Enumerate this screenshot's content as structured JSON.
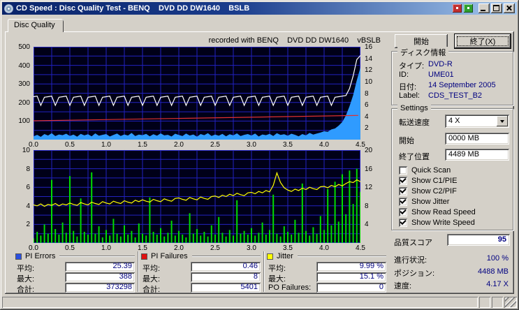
{
  "window": {
    "title": "CD Speed : Disc Quality Test - BENQ    DVD DD DW1640    BSLB"
  },
  "tab": {
    "label": "Disc Quality"
  },
  "toolbar": {
    "start_label": "開始",
    "exit_label": "終了(X)"
  },
  "chart_header": "recorded with BENQ    DVD DD DW1640    vBSLB",
  "disc_info": {
    "title": "ディスク情報",
    "rows": [
      {
        "label": "タイプ:",
        "value": "DVD-R"
      },
      {
        "label": "ID:",
        "value": "UME01"
      },
      {
        "label": "日付:",
        "value": "14 September 2005"
      },
      {
        "label": "Label:",
        "value": "CDS_TEST_B2"
      }
    ]
  },
  "settings": {
    "title": "Settings",
    "speed_label": "転送速度",
    "speed_value": "4 X",
    "start_label": "開始",
    "start_value": "0000 MB",
    "end_label": "終了位置",
    "end_value": "4489 MB",
    "checkboxes": [
      {
        "label": "Quick Scan",
        "checked": false
      },
      {
        "label": "Show C1/PIE",
        "checked": true
      },
      {
        "label": "Show C2/PIF",
        "checked": true
      },
      {
        "label": "Show Jitter",
        "checked": true
      },
      {
        "label": "Show Read Speed",
        "checked": true
      },
      {
        "label": "Show Write Speed",
        "checked": true
      }
    ]
  },
  "quality": {
    "label": "品質スコア",
    "value": "95"
  },
  "progress": [
    {
      "label": "進行状況:",
      "value": "100 %"
    },
    {
      "label": "ポジション:",
      "value": "4488 MB"
    },
    {
      "label": "速度:",
      "value": "4.17 X"
    }
  ],
  "stats": [
    {
      "name": "PI Errors",
      "color": "#2b50e0",
      "rows": [
        {
          "label": "平均:",
          "value": "25.39"
        },
        {
          "label": "最大:",
          "value": "388"
        },
        {
          "label": "合計:",
          "value": "373298"
        }
      ]
    },
    {
      "name": "PI Failures",
      "color": "#e01010",
      "rows": [
        {
          "label": "平均:",
          "value": "0.46"
        },
        {
          "label": "最大:",
          "value": "8"
        },
        {
          "label": "合計:",
          "value": "5401"
        }
      ]
    },
    {
      "name": "Jitter",
      "color": "#ffff00",
      "rows": [
        {
          "label": "平均:",
          "value": "9.99 %"
        },
        {
          "label": "最大:",
          "value": "15.1 %"
        },
        {
          "label": "PO Failures:",
          "value": "0"
        }
      ]
    }
  ],
  "chart_data": [
    {
      "type": "area",
      "title": "PI Errors / Read & Write Speed",
      "bg": "#000018",
      "grid_color": "#2222c0",
      "x_range": [
        0,
        4.5
      ],
      "x_grid_step": 0.25,
      "y_divisions": 10,
      "x_ticks": [
        [
          0,
          "0.0"
        ],
        [
          0.5,
          "0.5"
        ],
        [
          1,
          "1.0"
        ],
        [
          1.5,
          "1.5"
        ],
        [
          2,
          "2.0"
        ],
        [
          2.5,
          "2.5"
        ],
        [
          3,
          "3.0"
        ],
        [
          3.5,
          "3.5"
        ],
        [
          4,
          "4.0"
        ],
        [
          4.5,
          "4.5"
        ]
      ],
      "y_left": {
        "range": [
          0,
          500
        ],
        "ticks": [
          [
            500,
            "500"
          ],
          [
            400,
            "400"
          ],
          [
            300,
            "300"
          ],
          [
            200,
            "200"
          ],
          [
            100,
            "100"
          ]
        ]
      },
      "y_right": {
        "range": [
          0,
          16
        ],
        "ticks": [
          [
            16,
            "16"
          ],
          [
            14,
            "14"
          ],
          [
            12,
            "12"
          ],
          [
            10,
            "10"
          ],
          [
            8,
            "8"
          ],
          [
            6,
            "6"
          ],
          [
            4,
            "4"
          ],
          [
            2,
            "2"
          ]
        ]
      },
      "series": [
        {
          "name": "PI Errors",
          "type": "area",
          "axis": "left",
          "color": "#2f9bff",
          "step": 0.05,
          "values": [
            18,
            26,
            15,
            30,
            22,
            35,
            19,
            28,
            24,
            32,
            20,
            27,
            16,
            31,
            23,
            29,
            18,
            34,
            21,
            26,
            30,
            17,
            25,
            33,
            20,
            28,
            22,
            36,
            19,
            27,
            24,
            31,
            18,
            29,
            21,
            34,
            23,
            26,
            17,
            32,
            25,
            19,
            33,
            22,
            28,
            16,
            30,
            24,
            35,
            20,
            27,
            21,
            31,
            18,
            29,
            23,
            34,
            19,
            26,
            30,
            22,
            33,
            17,
            28,
            24,
            31,
            20,
            35,
            25,
            29,
            21,
            32,
            26,
            18,
            30,
            23,
            36,
            27,
            33,
            38,
            45,
            42,
            55,
            60,
            75,
            95,
            130,
            180,
            240,
            320,
            388
          ]
        },
        {
          "name": "Write Speed",
          "type": "line",
          "axis": "right",
          "color": "#ffffff",
          "step": 0.05,
          "values": [
            7.4,
            7.5,
            5.9,
            7.3,
            7.4,
            7.5,
            5.9,
            7.3,
            7.4,
            7.5,
            5.9,
            7.3,
            7.4,
            7.5,
            5.9,
            7.3,
            7.4,
            7.5,
            5.9,
            7.3,
            7.4,
            7.5,
            5.9,
            7.3,
            7.4,
            7.5,
            5.9,
            7.3,
            7.4,
            7.5,
            5.9,
            7.3,
            7.4,
            7.5,
            5.9,
            7.3,
            7.4,
            7.5,
            5.9,
            7.3,
            7.4,
            7.5,
            5.9,
            7.3,
            7.4,
            7.5,
            5.9,
            7.3,
            7.4,
            7.5,
            5.9,
            7.3,
            7.4,
            7.5,
            5.9,
            7.3,
            7.4,
            7.5,
            5.9,
            7.3,
            7.4,
            7.5,
            5.9,
            7.3,
            7.4,
            7.5,
            5.9,
            7.3,
            7.4,
            7.5,
            5.9,
            7.3,
            7.4,
            7.5,
            5.9,
            7.3,
            7.4,
            7.5,
            5.9,
            7.3,
            7.4,
            7.5,
            5.9,
            7.3,
            7.4,
            7.5,
            7.6,
            8.8,
            11.0,
            13.8,
            14.5
          ]
        },
        {
          "name": "Read Speed",
          "type": "line",
          "axis": "right",
          "color": "#e03030",
          "points": [
            [
              0,
              3.25
            ],
            [
              4.47,
              4.17
            ]
          ]
        }
      ]
    },
    {
      "type": "spikes",
      "title": "PI Failures / Jitter",
      "bg": "#000018",
      "grid_color": "#2222c0",
      "x_range": [
        0,
        4.5
      ],
      "x_grid_step": 0.25,
      "y_divisions": 10,
      "x_ticks": [
        [
          0,
          "0.0"
        ],
        [
          0.5,
          "0.5"
        ],
        [
          1,
          "1.0"
        ],
        [
          1.5,
          "1.5"
        ],
        [
          2,
          "2.0"
        ],
        [
          2.5,
          "2.5"
        ],
        [
          3,
          "3.0"
        ],
        [
          3.5,
          "3.5"
        ],
        [
          4,
          "4.0"
        ],
        [
          4.5,
          "4.5"
        ]
      ],
      "y_left": {
        "range": [
          0,
          10
        ],
        "ticks": [
          [
            10,
            "10"
          ],
          [
            8,
            "8"
          ],
          [
            6,
            "6"
          ],
          [
            4,
            "4"
          ],
          [
            2,
            "2"
          ]
        ]
      },
      "y_right": {
        "range": [
          0,
          20
        ],
        "ticks": [
          [
            20,
            "20"
          ],
          [
            16,
            "16"
          ],
          [
            12,
            "12"
          ],
          [
            8,
            "8"
          ],
          [
            4,
            "4"
          ]
        ]
      },
      "series": [
        {
          "name": "PI Failures",
          "type": "spikes",
          "axis": "left",
          "color": "#00dc00",
          "step": 0.05,
          "values": [
            0.5,
            1.2,
            0.8,
            2.0,
            1.0,
            6.8,
            1.5,
            0.9,
            2.2,
            1.1,
            7.2,
            1.3,
            0.7,
            4.8,
            1.2,
            0.9,
            7.6,
            1.0,
            1.8,
            0.6,
            1.4,
            0.8,
            2.6,
            1.0,
            0.7,
            1.9,
            0.9,
            1.3,
            0.6,
            2.1,
            1.0,
            0.8,
            4.9,
            1.2,
            0.9,
            1.6,
            0.7,
            1.1,
            2.4,
            0.8,
            1.3,
            0.9,
            0.6,
            3.2,
            1.0,
            1.5,
            0.8,
            1.2,
            0.7,
            1.9,
            0.9,
            2.8,
            1.1,
            0.7,
            1.4,
            0.8,
            4.6,
            1.0,
            1.3,
            0.9,
            1.6,
            0.8,
            1.1,
            2.2,
            0.9,
            1.4,
            5.2,
            1.0,
            0.7,
            1.8,
            1.2,
            0.9,
            2.5,
            1.1,
            6.4,
            1.3,
            0.8,
            1.7,
            1.0,
            2.9,
            1.4,
            5.8,
            1.9,
            6.6,
            2.3,
            7.4,
            3.1,
            7.8,
            4.2,
            8.0,
            5.5
          ]
        },
        {
          "name": "Jitter",
          "type": "line",
          "axis": "right",
          "color": "#ffff00",
          "step": 0.05,
          "values": [
            8.2,
            8.0,
            8.4,
            7.9,
            8.3,
            8.1,
            8.5,
            8.0,
            8.4,
            8.2,
            8.6,
            8.3,
            8.1,
            8.7,
            8.4,
            8.2,
            8.8,
            8.5,
            8.3,
            8.9,
            8.6,
            8.4,
            9.0,
            8.7,
            8.5,
            9.1,
            8.8,
            8.6,
            9.2,
            8.9,
            9.3,
            9.0,
            8.8,
            9.4,
            9.1,
            8.9,
            9.5,
            9.2,
            9.0,
            9.6,
            9.7,
            9.4,
            9.2,
            9.8,
            9.5,
            9.3,
            9.9,
            9.6,
            9.4,
            10.0,
            10.1,
            9.8,
            10.3,
            10.0,
            10.5,
            10.2,
            10.7,
            10.4,
            10.2,
            10.8,
            10.9,
            10.6,
            11.1,
            10.8,
            11.3,
            11.0,
            12.4,
            15.1,
            13.0,
            11.9,
            11.4,
            11.1,
            11.6,
            11.3,
            11.8,
            11.5,
            12.0,
            11.7,
            11.5,
            12.1,
            12.2,
            11.9,
            12.4,
            12.1,
            12.6,
            12.3,
            12.8,
            13.2,
            13.0,
            13.6,
            13.2
          ]
        }
      ]
    }
  ]
}
